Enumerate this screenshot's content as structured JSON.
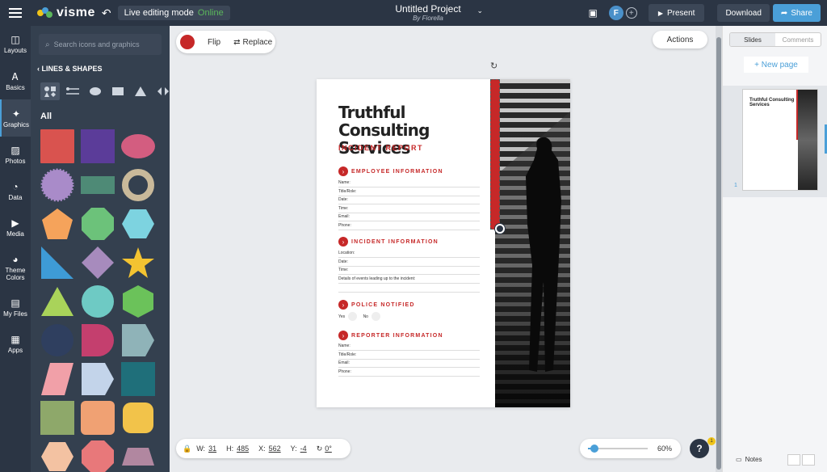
{
  "topbar": {
    "logo_text": "visme",
    "live_mode_label": "Live editing mode",
    "live_status": "Online",
    "project_name": "Untitled Project",
    "project_author": "By Fiorella",
    "avatar_initial": "F",
    "present_label": "Present",
    "download_label": "Download",
    "share_label": "Share"
  },
  "leftnav": {
    "items": [
      {
        "label": "Layouts",
        "icon": "layout-icon"
      },
      {
        "label": "Basics",
        "icon": "basics-icon"
      },
      {
        "label": "Graphics",
        "icon": "graphics-icon"
      },
      {
        "label": "Photos",
        "icon": "photo-icon"
      },
      {
        "label": "Data",
        "icon": "chart-icon"
      },
      {
        "label": "Media",
        "icon": "media-icon"
      },
      {
        "label": "Theme Colors",
        "icon": "palette-icon"
      },
      {
        "label": "My Files",
        "icon": "files-icon"
      },
      {
        "label": "Apps",
        "icon": "apps-icon"
      }
    ]
  },
  "panel": {
    "search_placeholder": "Search icons and graphics",
    "title": "LINES & SHAPES",
    "section": "All"
  },
  "toolbar": {
    "flip_label": "Flip",
    "replace_label": "Replace",
    "actions_label": "Actions"
  },
  "doc": {
    "title": "Truthful Consulting Services",
    "subtitle": "INCIDENT REPORT",
    "sections": [
      {
        "label": "EMPLOYEE INFORMATION",
        "fields": [
          "Name:",
          "Title/Role:",
          "Date:",
          "Time:",
          "Email:",
          "Phone:"
        ]
      },
      {
        "label": "INCIDENT INFORMATION",
        "fields": [
          "Location:",
          "Date:",
          "Time:",
          "Details of events leading up to the incident:"
        ]
      },
      {
        "label": "POLICE NOTIFIED",
        "options": [
          "Yes",
          "No"
        ]
      },
      {
        "label": "REPORTER INFORMATION",
        "fields": [
          "Name:",
          "Title/Role:",
          "Email:",
          "Phone:"
        ]
      }
    ]
  },
  "dims": {
    "w_label": "W:",
    "w": "31",
    "h_label": "H:",
    "h": "485",
    "x_label": "X:",
    "x": "562",
    "y_label": "Y:",
    "y": "-4",
    "rot": "0°"
  },
  "zoom": {
    "value": "60%",
    "fraction": 0.05
  },
  "help": {
    "label": "?",
    "badge": "1"
  },
  "rightpanel": {
    "tab_slides": "Slides",
    "tab_comments": "Comments",
    "new_page": "+ New page",
    "slide_number": "1",
    "thumb_title": "Truthful Consulting Services",
    "notes_label": "Notes"
  },
  "colors": {
    "accent": "#c62828",
    "brand": "#2b3544",
    "primary": "#4a9fd8"
  }
}
